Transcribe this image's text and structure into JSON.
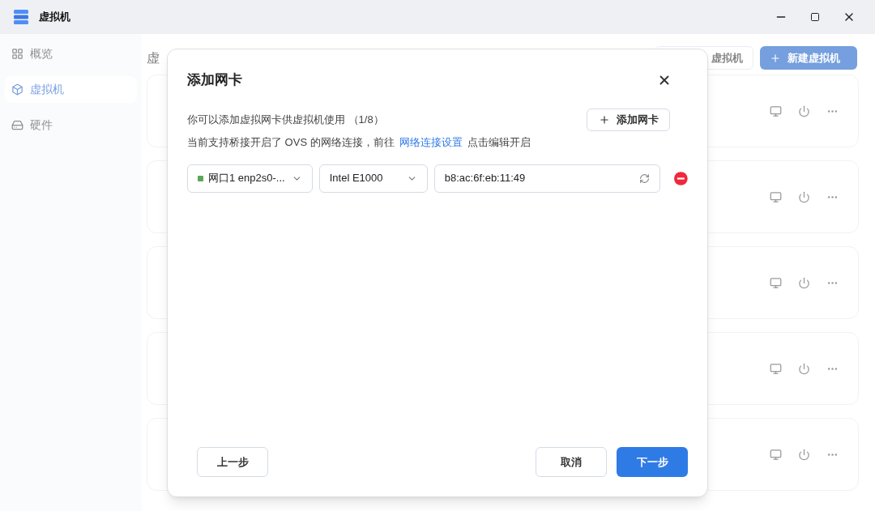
{
  "window": {
    "title": "虚拟机"
  },
  "sidebar": {
    "items": [
      {
        "label": "概览",
        "selected": false,
        "kind": "grid"
      },
      {
        "label": "虚拟机",
        "selected": true,
        "kind": "cube"
      },
      {
        "label": "硬件",
        "selected": false,
        "kind": "drive"
      }
    ]
  },
  "page": {
    "heading": "虚",
    "toolbar": [
      {
        "label": "虚拟机",
        "kind": "secondary"
      },
      {
        "label": "新建虚拟机",
        "kind": "primary"
      }
    ]
  },
  "dialog": {
    "title": "添加网卡",
    "description": "你可以添加虚拟网卡供虚拟机使用 （1/8）",
    "add_button": "添加网卡",
    "note_before": "当前支持桥接开启了 OVS 的网络连接，前往",
    "note_link": "网络连接设置",
    "note_after": "点击编辑开启",
    "nics": [
      {
        "port": "网口1 enp2s0-...",
        "color": "#5aa855",
        "model": "Intel E1000",
        "mac": "b8:ac:6f:eb:11:49"
      }
    ],
    "buttons": [
      {
        "label": "上一步",
        "kind": "secondary"
      },
      {
        "label": "取消",
        "kind": "secondary"
      },
      {
        "label": "下一步",
        "kind": "primary"
      }
    ]
  }
}
